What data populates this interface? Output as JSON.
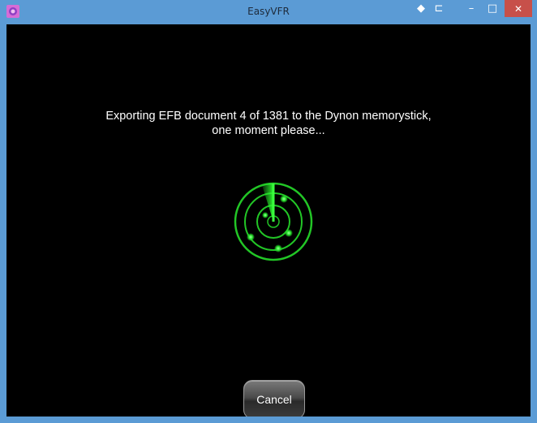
{
  "window": {
    "title": "EasyVFR",
    "app_icon": "easyvfr-app-icon",
    "controls": {
      "extra1": "◆",
      "extra2": "⊏",
      "minimize": "–",
      "maximize": "□",
      "close": "✕"
    }
  },
  "dialog": {
    "message_line1": "Exporting EFB document 4 of 1381 to the Dynon memorystick,",
    "message_line2": "one moment please...",
    "spinner_icon": "radar-icon",
    "cancel_label": "Cancel"
  },
  "colors": {
    "titlebar": "#5b9bd5",
    "close_button": "#c7504a",
    "background": "#000000",
    "radar_green": "#27e32b"
  }
}
